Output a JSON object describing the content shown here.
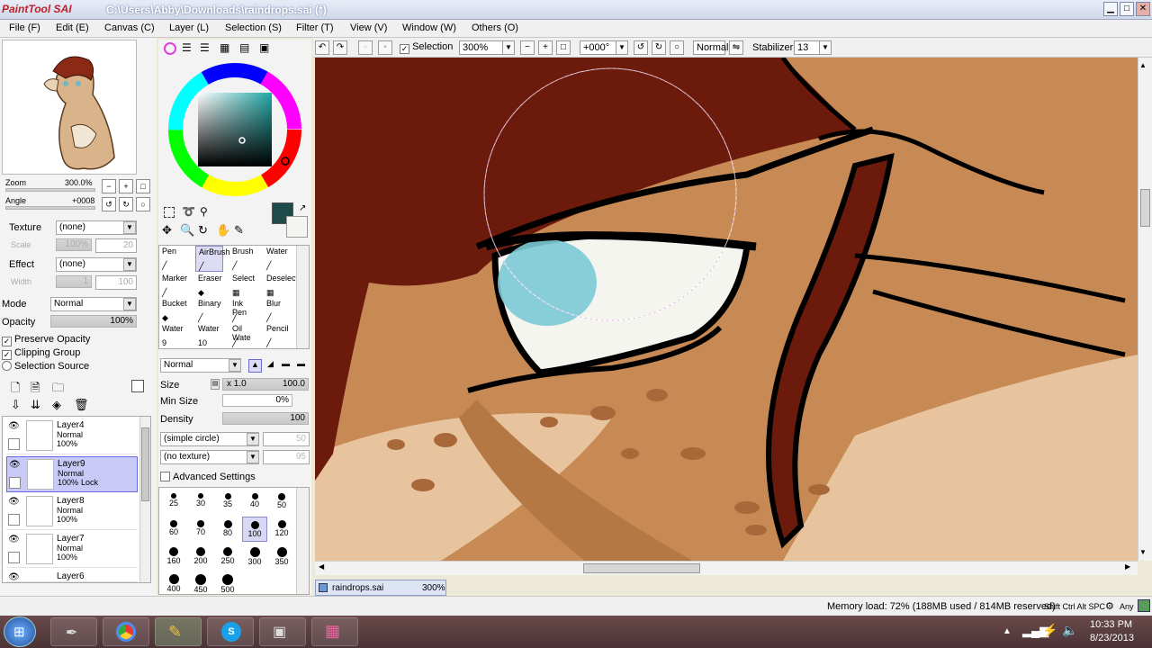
{
  "app": {
    "logo_text": "PaintTool SAI",
    "window_title": "C:\\Users\\Abby\\Downloads\\raindrops.sai (*)"
  },
  "menu": [
    "File (F)",
    "Edit (E)",
    "Canvas (C)",
    "Layer (L)",
    "Selection (S)",
    "Filter (T)",
    "View (V)",
    "Window (W)",
    "Others (O)"
  ],
  "navigator": {
    "zoom_label": "Zoom",
    "zoom_value": "300.0%",
    "angle_label": "Angle",
    "angle_value": "+0008"
  },
  "texture": {
    "label": "Texture",
    "value": "(none)"
  },
  "texture_scale": {
    "label": "Scale",
    "value": "100%",
    "num": "20"
  },
  "effect": {
    "label": "Effect",
    "value": "(none)"
  },
  "effect_width": {
    "label": "Width",
    "value": "1",
    "num": "100"
  },
  "layer_props": {
    "mode_label": "Mode",
    "mode_value": "Normal",
    "opacity_label": "Opacity",
    "opacity_value": "100%",
    "preserve_opacity": "Preserve Opacity",
    "clipping_group": "Clipping Group",
    "selection_source": "Selection Source"
  },
  "layers": [
    {
      "name": "Layer4",
      "mode": "Normal",
      "opacity": "100%",
      "selected": false
    },
    {
      "name": "Layer9",
      "mode": "Normal",
      "opacity": "100%",
      "lock": "Lock",
      "selected": true
    },
    {
      "name": "Layer8",
      "mode": "Normal",
      "opacity": "100%",
      "selected": false
    },
    {
      "name": "Layer7",
      "mode": "Normal",
      "opacity": "100%",
      "selected": false
    },
    {
      "name": "Layer6",
      "mode": "",
      "opacity": "",
      "selected": false
    }
  ],
  "colors": {
    "primary": "#1e4a4a",
    "secondary": "#f4f4f0",
    "canvas_skin": "#c88a55",
    "hair": "#6b1a0c",
    "iris": "#7ccad6"
  },
  "tools": [
    {
      "label": "Pen",
      "sub": ""
    },
    {
      "label": "AirBrush",
      "sub": ""
    },
    {
      "label": "Brush",
      "sub": ""
    },
    {
      "label": "Water",
      "sub": ""
    },
    {
      "label": "Marker",
      "sub": ""
    },
    {
      "label": "Eraser",
      "sub": ""
    },
    {
      "label": "Select",
      "sub": ""
    },
    {
      "label": "Deselect",
      "sub": ""
    },
    {
      "label": "Bucket",
      "sub": ""
    },
    {
      "label": "Binary",
      "sub": ""
    },
    {
      "label": "Ink Pen",
      "sub": ""
    },
    {
      "label": "Blur",
      "sub": ""
    },
    {
      "label": "Water",
      "sub": "9"
    },
    {
      "label": "Water",
      "sub": "10"
    },
    {
      "label": "Oil Wate",
      "sub": ""
    },
    {
      "label": "Pencil",
      "sub": ""
    }
  ],
  "brush": {
    "blend_mode": "Normal",
    "size_label": "Size",
    "size_mult": "x 1.0",
    "size_value": "100.0",
    "min_size_label": "Min Size",
    "min_size_value": "0%",
    "density_label": "Density",
    "density_value": "100",
    "shape": "(simple circle)",
    "shape_num": "50",
    "texture": "(no texture)",
    "texture_num": "95",
    "advanced": "Advanced Settings"
  },
  "brush_sizes": [
    "25",
    "30",
    "35",
    "40",
    "50",
    "60",
    "70",
    "80",
    "100",
    "120",
    "160",
    "200",
    "250",
    "300",
    "350",
    "400",
    "450",
    "500"
  ],
  "toolbar": {
    "selection_label": "Selection",
    "zoom": "300%",
    "angle": "+000°",
    "blend": "Normal",
    "stabilizer_label": "Stabilizer",
    "stabilizer_value": "13"
  },
  "document_tab": {
    "name": "raindrops.sai",
    "zoom": "300%"
  },
  "status": {
    "memory": "Memory load: 72% (188MB used / 814MB reserved)",
    "keys": "Shift Ctrl Alt SPC",
    "any": "Any"
  },
  "clock": {
    "time": "10:33 PM",
    "date": "8/23/2013"
  }
}
